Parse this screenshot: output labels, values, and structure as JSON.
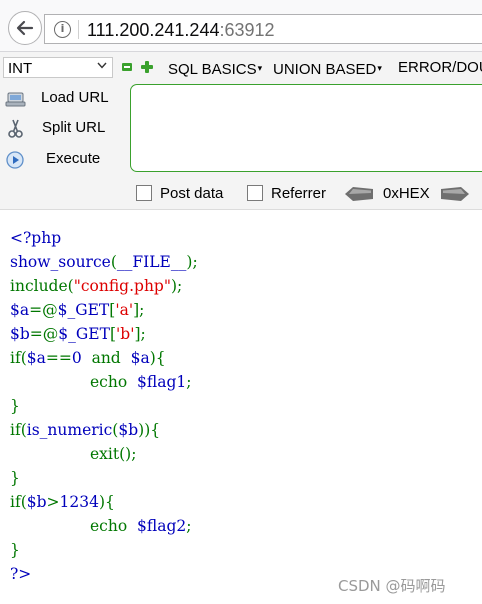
{
  "address_bar": {
    "url_host": "111.200.241.244",
    "url_port": ":63912"
  },
  "hackbar": {
    "select_value": "INT",
    "menus": {
      "sql_basics": "SQL BASICS",
      "union_based": "UNION BASED",
      "error_double": "ERROR/DOU"
    },
    "actions": {
      "load_url": "Load URL",
      "split_url": "Split URL",
      "execute": "Execute"
    },
    "textarea_value": "",
    "checkboxes": {
      "post_data": "Post data",
      "referrer": "Referrer"
    },
    "hex_label": "0xHEX"
  },
  "code": {
    "l1": "<?php",
    "l2a": "show_source",
    "l2b": "(",
    "l2c": "__FILE__",
    "l2d": ");",
    "l3a": "include(",
    "l3b": "\"config.php\"",
    "l3c": ");",
    "l4a": "$a",
    "l4b": "=@",
    "l4c": "$_GET",
    "l4d": "[",
    "l4e": "'a'",
    "l4f": "];",
    "l5a": "$b",
    "l5b": "=@",
    "l5c": "$_GET",
    "l5d": "[",
    "l5e": "'b'",
    "l5f": "];",
    "l6a": "if(",
    "l6b": "$a",
    "l6c": "==",
    "l6d": "0",
    "l6e": "  and  ",
    "l6f": "$a",
    "l6g": "){",
    "l7a": "echo  ",
    "l7b": "$flag1",
    "l7c": ";",
    "l8": "}",
    "l9a": "if(",
    "l9b": "is_numeric",
    "l9c": "(",
    "l9d": "$b",
    "l9e": ")){",
    "l10a": "exit",
    "l10b": "();",
    "l11": "}",
    "l12a": "if(",
    "l12b": "$b",
    "l12c": ">",
    "l12d": "1234",
    "l12e": "){",
    "l13a": "echo  ",
    "l13b": "$flag2",
    "l13c": ";",
    "l14": "}",
    "l15": "?>"
  },
  "watermark": "CSDN @码啊码",
  "colors": {
    "php_default": "#0000bb",
    "php_keyword": "#007700",
    "php_string": "#dd0000",
    "hackbar_green": "#3aa12d"
  }
}
